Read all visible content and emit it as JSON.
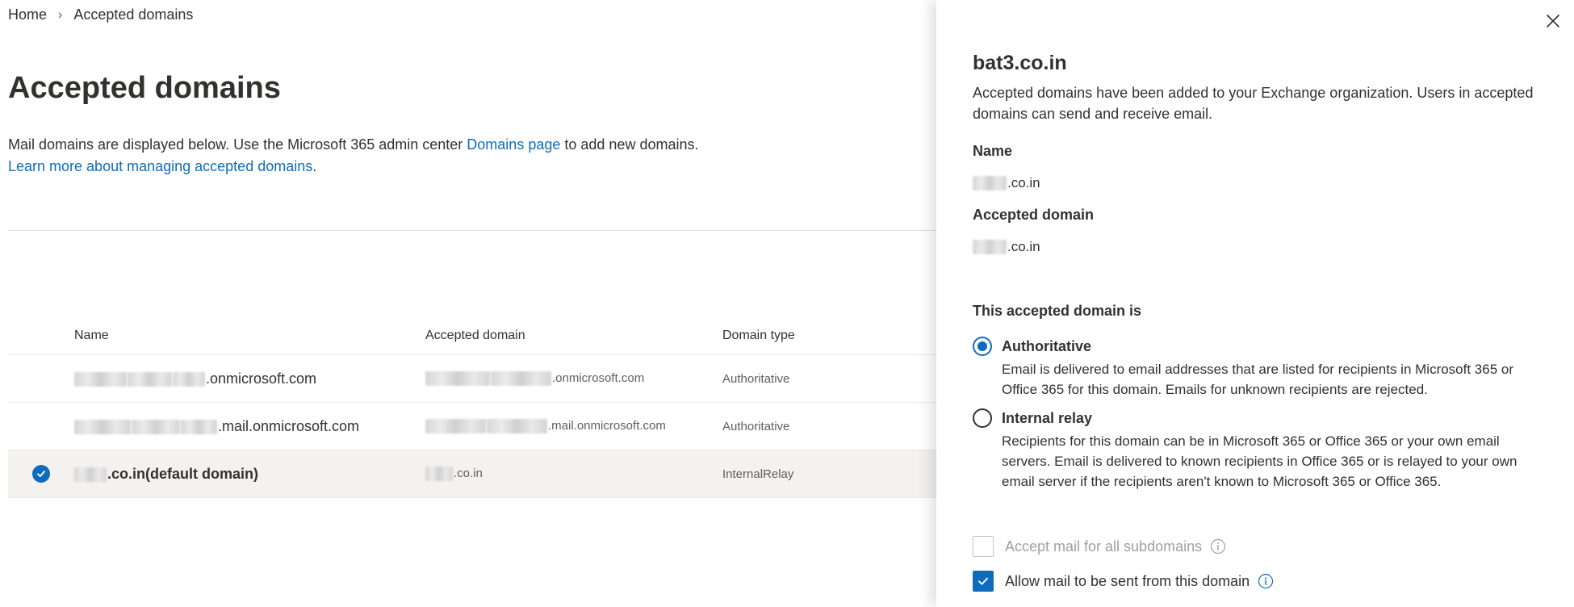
{
  "breadcrumb": {
    "home": "Home",
    "separator": "›",
    "current": "Accepted domains"
  },
  "page": {
    "title": "Accepted domains",
    "description_part1": "Mail domains are displayed below. Use the Microsoft 365 admin center ",
    "domains_link": "Domains page",
    "description_part2": " to add new domains. ",
    "learn_more_link": "Learn more about managing accepted domains",
    "description_part3": "."
  },
  "table": {
    "columns": {
      "name": "Name",
      "accepted_domain": "Accepted domain",
      "domain_type": "Domain type"
    },
    "rows": [
      {
        "name_suffix": ".onmicrosoft.com",
        "accepted_suffix": ".onmicrosoft.com",
        "type": "Authoritative",
        "selected": false
      },
      {
        "name_suffix": ".mail.onmicrosoft.com",
        "accepted_suffix": ".mail.onmicrosoft.com",
        "type": "Authoritative",
        "selected": false
      },
      {
        "name_suffix": ".co.in(default domain)",
        "accepted_suffix": ".co.in",
        "type": "InternalRelay",
        "selected": true
      }
    ]
  },
  "panel": {
    "title": "bat3.co.in",
    "description": "Accepted domains have been added to your Exchange organization. Users in accepted domains can send and receive email.",
    "name_label": "Name",
    "name_value": ".co.in",
    "accepted_label": "Accepted domain",
    "accepted_value": ".co.in",
    "section_label": "This accepted domain is",
    "options": {
      "authoritative": {
        "title": "Authoritative",
        "desc": "Email is delivered to email addresses that are listed for recipients in Microsoft 365 or Office 365 for this domain. Emails for unknown recipients are rejected.",
        "checked": true
      },
      "internal_relay": {
        "title": "Internal relay",
        "desc": "Recipients for this domain can be in Microsoft 365 or Office 365 or your own email servers. Email is delivered to known recipients in Office 365 or is relayed to your own email server if the recipients aren't known to Microsoft 365 or Office 365.",
        "checked": false
      }
    },
    "accept_subdomains_label": "Accept mail for all subdomains",
    "allow_send_label": "Allow mail to be sent from this domain"
  },
  "colors": {
    "accent": "#0f6cbd",
    "text": "#323130",
    "muted": "#605e5c",
    "disabled": "#a19f9d",
    "selected_row": "#f3f2f1"
  },
  "icons": {
    "close": "close-icon",
    "check": "checkmark-icon",
    "info": "info-icon",
    "chevron": "chevron-right-icon"
  }
}
